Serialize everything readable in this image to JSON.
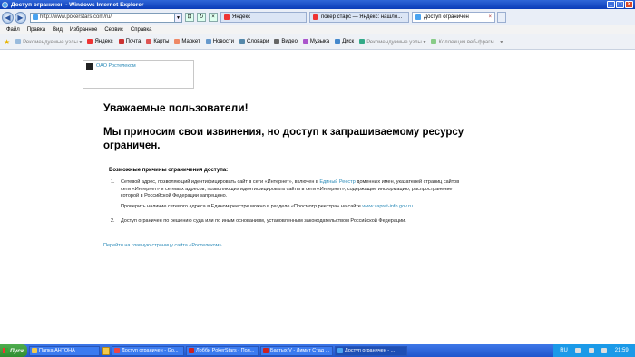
{
  "window": {
    "title": "Доступ ограничен - Windows Internet Explorer"
  },
  "address": {
    "url": "http://www.pokerstars.com/ru/"
  },
  "tabs": [
    {
      "label": "Яндекс",
      "icon": "yandex-icon",
      "active": false
    },
    {
      "label": "покер старс — Яндекс: нашло...",
      "icon": "yandex-icon",
      "active": false
    },
    {
      "label": "Доступ ограничен",
      "icon": "ie-page-icon",
      "active": true
    }
  ],
  "menu": [
    "Файл",
    "Правка",
    "Вид",
    "Избранное",
    "Сервис",
    "Справка"
  ],
  "favorites": [
    {
      "label": "Рекомендуемые узлы ▾",
      "dim": true
    },
    {
      "label": "Яндекс",
      "dim": false
    },
    {
      "label": "Почта",
      "dim": false
    },
    {
      "label": "Карты",
      "dim": false
    },
    {
      "label": "Маркет",
      "dim": false
    },
    {
      "label": "Новости",
      "dim": false
    },
    {
      "label": "Словари",
      "dim": false
    },
    {
      "label": "Видео",
      "dim": false
    },
    {
      "label": "Музыка",
      "dim": false
    },
    {
      "label": "Диск",
      "dim": false
    },
    {
      "label": "Рекомендуемые узлы ▾",
      "dim": true
    },
    {
      "label": "Коллекция веб-фрагм... ▾",
      "dim": true
    }
  ],
  "page": {
    "logo_text": "ОАО Ростелеком",
    "heading": "Уважаемые пользователи!",
    "message": "Мы приносим свои извинения, но доступ к запрашиваемому ресурсу ограничен.",
    "reasons_title": "Возможные причины ограничения доступа:",
    "reason1_num": "1.",
    "reason1_part1": "Сетевой адрес, позволяющий идентифицировать сайт в сети «Интернет», включен в ",
    "reason1_link": "Единый Реестр",
    "reason1_part2": " доменных имен, указателей страниц сайтов сети «Интернет» и сетевых адресов, позволяющих идентифицировать сайты в сети «Интернет», содержащие информацию, распространение которой в Российской Федерации запрещено.",
    "reason1_check": "Проверить наличие сетевого адреса в Едином реестре можно в разделе «Просмотр реестра» на сайте ",
    "reason1_check_link": "www.zapret-info.gov.ru",
    "reason1_check_end": ".",
    "reason2_num": "2.",
    "reason2_text": "Доступ ограничен  по решению суда или по иным основаниям, установленным законодательством Российской Федерации.",
    "home_link": "Перейти на главную страницу сайта «Ростелеком»"
  },
  "taskbar": {
    "start_label": "Пуск",
    "tasks": [
      {
        "label": "Папка АНТОНА",
        "icon": "folder-icon",
        "active": false
      },
      {
        "label": "Доступ ограничен - Go...",
        "icon": "chrome-icon",
        "active": false
      },
      {
        "label": "Лобби PokerStars - Пол...",
        "icon": "pokerstars-icon",
        "active": false
      },
      {
        "label": "Бастых V - Лимит Стад ...",
        "icon": "pokerstars-icon",
        "active": false
      },
      {
        "label": "Доступ ограничен - ...",
        "icon": "ie-icon",
        "active": true
      }
    ],
    "lang": "RU",
    "clock": "21:59"
  },
  "colors": {
    "link": "#2a8ab8",
    "titlebar": "#0a3cb8",
    "taskbar": "#1f55cc",
    "start": "#2f8c2f"
  }
}
